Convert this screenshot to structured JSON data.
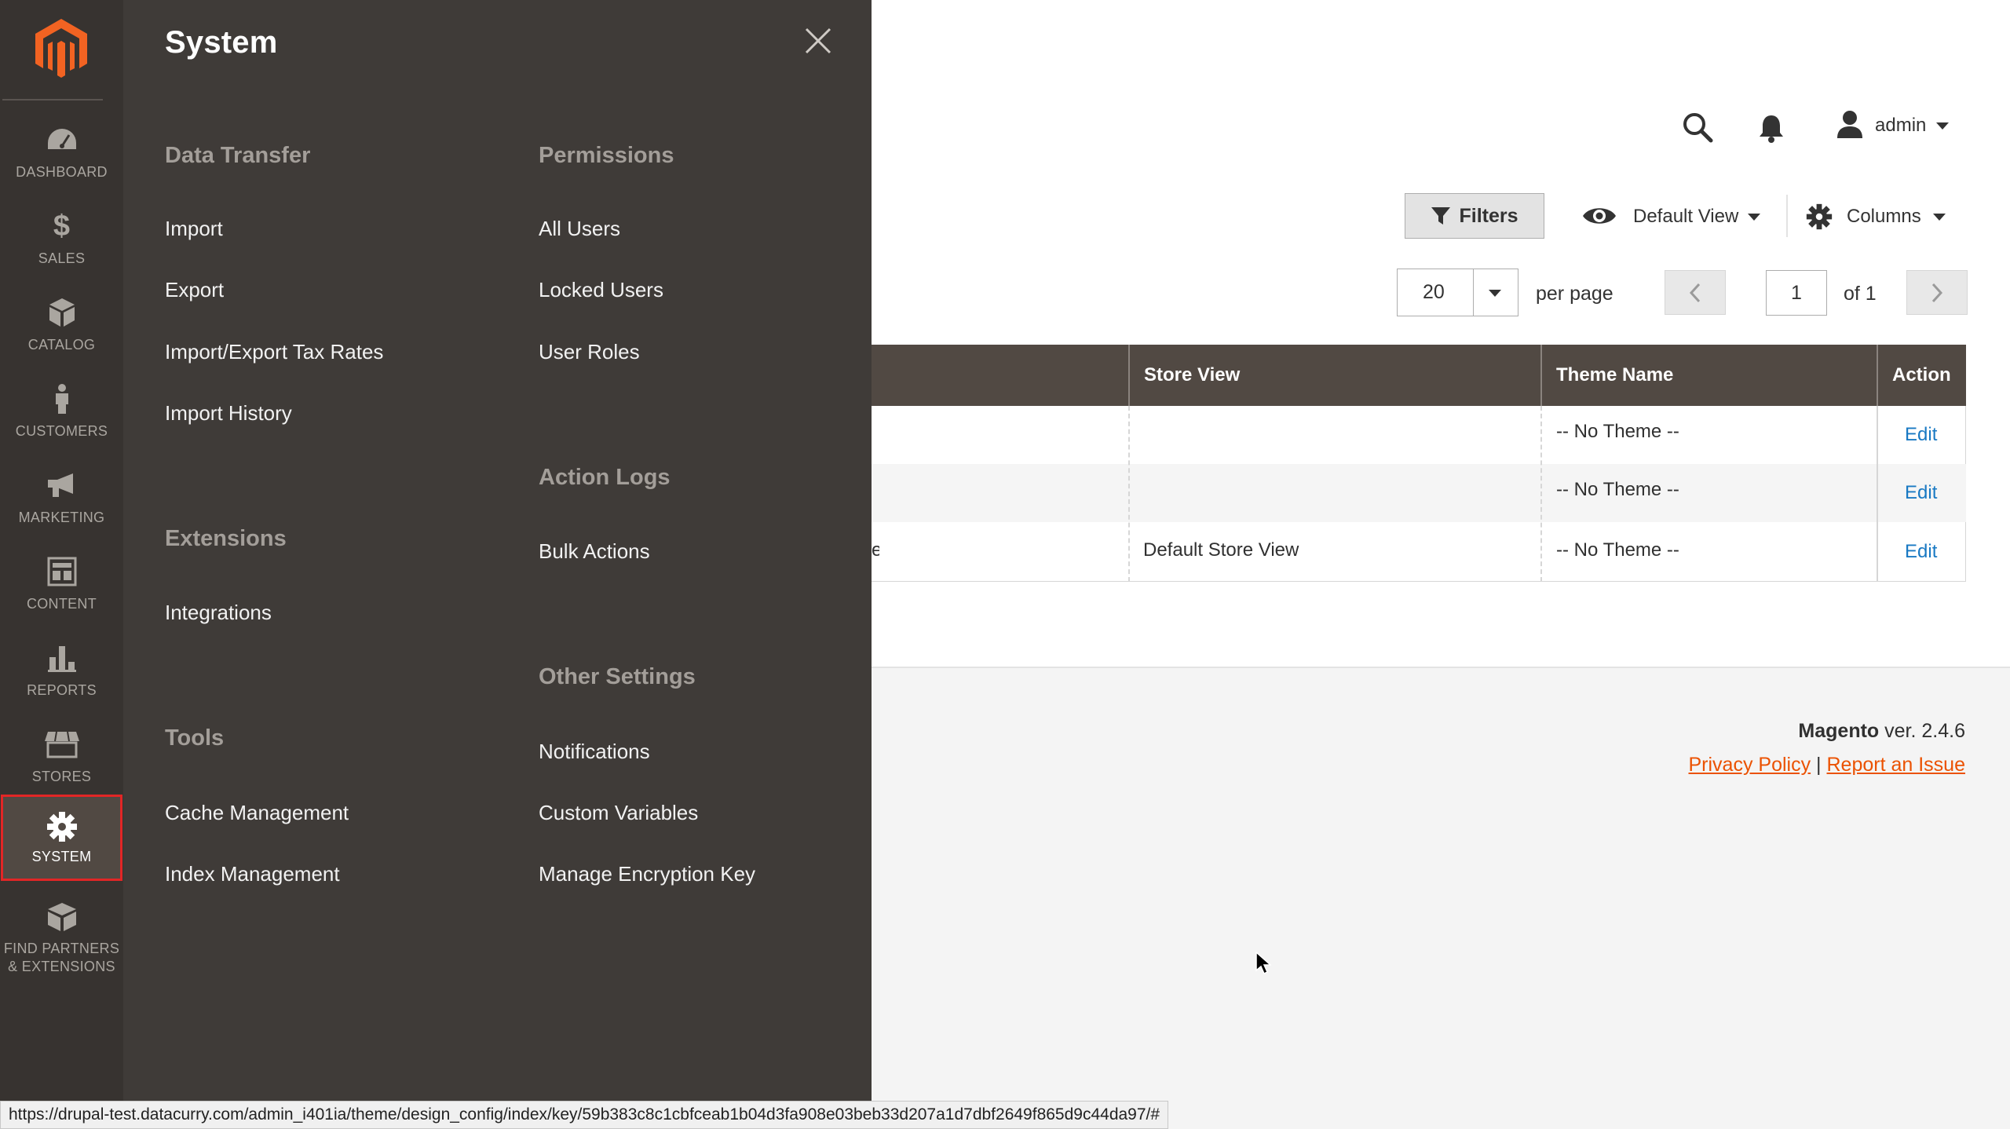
{
  "nav": {
    "logo_name": "magento-logo",
    "items": [
      {
        "id": "dashboard",
        "label": "DASHBOARD",
        "icon": "dashboard-icon"
      },
      {
        "id": "sales",
        "label": "SALES",
        "icon": "dollar-icon"
      },
      {
        "id": "catalog",
        "label": "CATALOG",
        "icon": "box-icon"
      },
      {
        "id": "customers",
        "label": "CUSTOMERS",
        "icon": "person-icon"
      },
      {
        "id": "marketing",
        "label": "MARKETING",
        "icon": "megaphone-icon"
      },
      {
        "id": "content",
        "label": "CONTENT",
        "icon": "layout-icon"
      },
      {
        "id": "reports",
        "label": "REPORTS",
        "icon": "bar-chart-icon"
      },
      {
        "id": "stores",
        "label": "STORES",
        "icon": "store-icon"
      },
      {
        "id": "system",
        "label": "SYSTEM",
        "icon": "gear-icon",
        "active": true
      },
      {
        "id": "partners",
        "label_line1": "FIND PARTNERS",
        "label_line2": "& EXTENSIONS",
        "icon": "cubes-icon"
      }
    ],
    "active_outline_color": "#e22626"
  },
  "panel": {
    "title": "System",
    "sections": {
      "data_transfer": {
        "heading": "Data Transfer",
        "links": [
          "Import",
          "Export",
          "Import/Export Tax Rates",
          "Import History"
        ]
      },
      "extensions": {
        "heading": "Extensions",
        "links": [
          "Integrations"
        ]
      },
      "tools": {
        "heading": "Tools",
        "links": [
          "Cache Management",
          "Index Management"
        ]
      },
      "permissions": {
        "heading": "Permissions",
        "links": [
          "All Users",
          "Locked Users",
          "User Roles"
        ]
      },
      "action_logs": {
        "heading": "Action Logs",
        "links": [
          "Bulk Actions"
        ]
      },
      "other_settings": {
        "heading": "Other Settings",
        "links": [
          "Notifications",
          "Custom Variables",
          "Manage Encryption Key"
        ]
      }
    }
  },
  "header": {
    "user": "admin"
  },
  "toolbar": {
    "filters_label": "Filters",
    "view_label": "Default View",
    "columns_label": "Columns"
  },
  "pagination": {
    "per_page_value": "20",
    "per_page_label": "per page",
    "current_page": "1",
    "of_label": "of 1"
  },
  "grid": {
    "columns": [
      "Store View",
      "Theme Name",
      "Action"
    ],
    "rows": [
      {
        "store_view": "",
        "theme": "-- No Theme --",
        "action": "Edit"
      },
      {
        "store_view": "",
        "theme": "-- No Theme --",
        "action": "Edit"
      },
      {
        "store_view": "Default Store View",
        "theme": "-- No Theme --",
        "action": "Edit"
      }
    ],
    "truncated_fragment": "e"
  },
  "footer": {
    "brand": "Magento",
    "version": " ver. 2.4.6",
    "privacy": "Privacy Policy",
    "separator": "|",
    "report": "Report an Issue"
  },
  "status_url": "https://drupal-test.datacurry.com/admin_i401ia/theme/design_config/index/key/59b383c8c1cbfceab1b04d3fa908e03beb33d207a1d7dbf2649f865d9c44da97/#",
  "colors": {
    "nav_bg": "#373330",
    "panel_bg": "#3f3b38",
    "grid_header": "#514943",
    "link_blue": "#1979c3",
    "footer_link": "#eb5202",
    "brand_orange": "#eb5202"
  }
}
